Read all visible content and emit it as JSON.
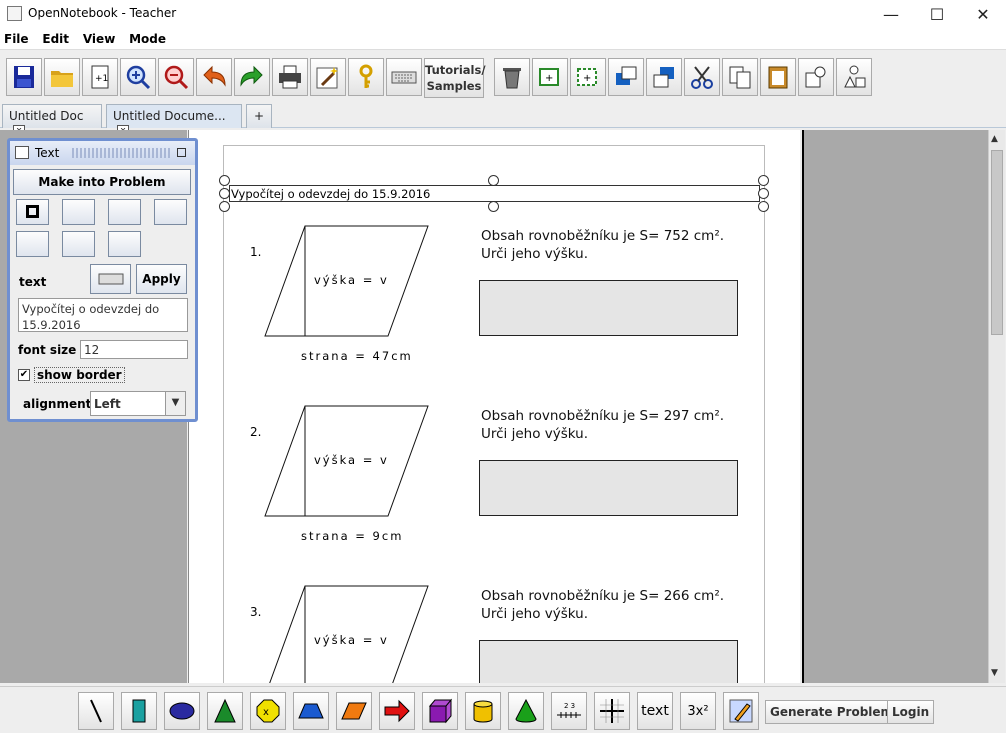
{
  "window": {
    "title": "OpenNotebook - Teacher"
  },
  "menu": [
    "File",
    "Edit",
    "View",
    "Mode"
  ],
  "toolbar": {
    "icons": [
      "save-icon",
      "open-folder-icon",
      "add-page-icon",
      "zoom-in-icon",
      "zoom-out-icon",
      "undo-icon",
      "redo-icon",
      "print-icon",
      "magic-wand-icon",
      "key-icon",
      "keyboard-icon"
    ],
    "tutorials_label_1": "Tutorials/",
    "tutorials_label_2": "Samples",
    "icons2": [
      "trash-icon",
      "group-icon",
      "ungroup-icon",
      "bring-front-icon",
      "send-back-icon",
      "cut-icon",
      "copy-icon",
      "paste-icon",
      "shapes-icon",
      "shapes-alt-icon"
    ]
  },
  "tabs": [
    {
      "label": "Untitled Doc",
      "close": "x"
    },
    {
      "label": "Untitled Docume...",
      "close": "x"
    },
    {
      "label": "+"
    }
  ],
  "text_panel": {
    "title": "Text",
    "make_problem_label": "Make into Problem",
    "text_label": "text",
    "apply_label": "Apply",
    "text_value": "Vypočítej o odevzdej do 15.9.2016",
    "font_size_label": "font size",
    "font_size_value": "12",
    "show_border_label": "show border",
    "show_border_checked": true,
    "alignment_label": "alignment",
    "alignment_value": "Left"
  },
  "document": {
    "header_text": "Vypočítej o odevzdej do 15.9.2016",
    "problems": [
      {
        "number": "1.",
        "height_label": "výška = v",
        "base_label": "strana = 47cm",
        "line1": "Obsah rovnoběžníku je S= 752 cm².",
        "line2": "Urči jeho výšku."
      },
      {
        "number": "2.",
        "height_label": "výška = v",
        "base_label": "strana = 9cm",
        "line1": "Obsah rovnoběžníku je S= 297 cm².",
        "line2": "Urči jeho výšku."
      },
      {
        "number": "3.",
        "height_label": "výška = v",
        "base_label": "",
        "line1": "Obsah rovnoběžníku je S= 266 cm².",
        "line2": "Urči jeho výšku."
      }
    ]
  },
  "bottom_toolbar": {
    "icons": [
      "line-icon",
      "rectangle-icon",
      "oval-icon",
      "triangle-icon",
      "octagon-icon",
      "trapezoid-icon",
      "parallelogram-icon",
      "arrow-icon",
      "cube-icon",
      "cylinder-icon",
      "cone-icon",
      "number-line-icon",
      "grid-icon"
    ],
    "text_label": "text",
    "expression_label": "3x²",
    "generate_label": "Generate Problems",
    "login_label": "Login"
  }
}
